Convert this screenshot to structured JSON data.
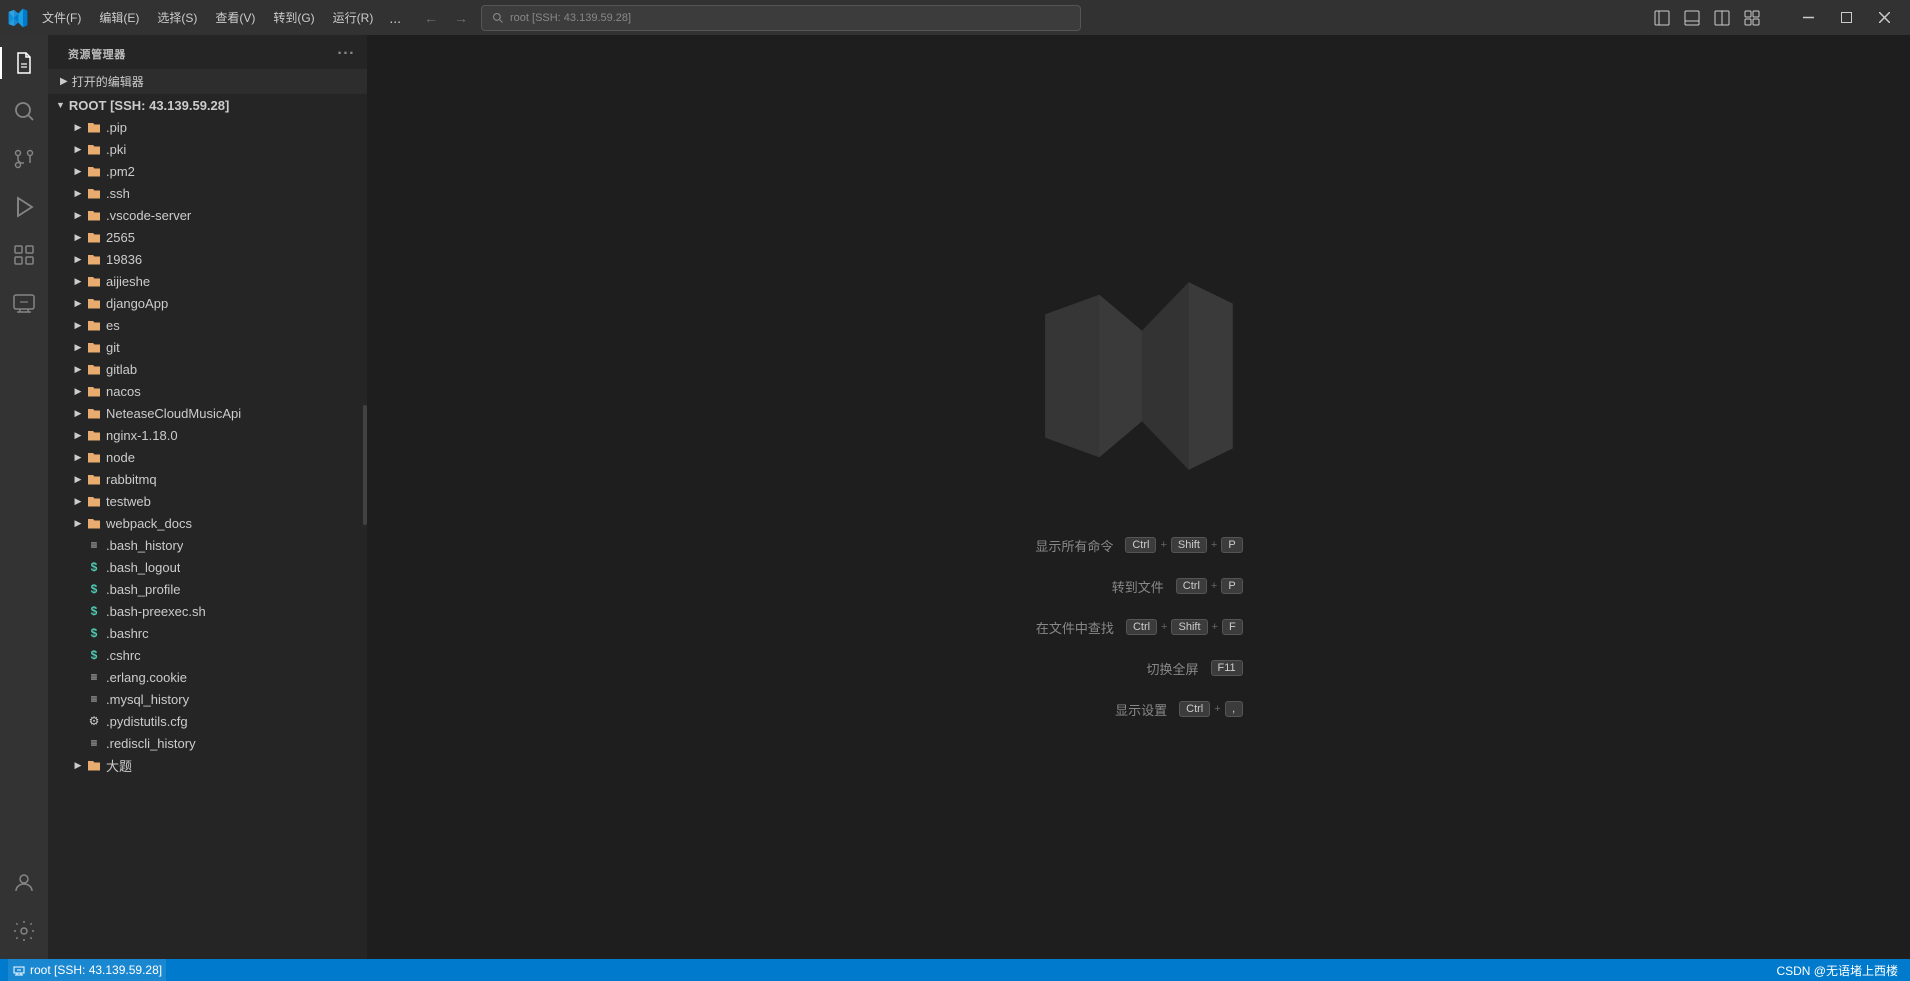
{
  "titleBar": {
    "appIcon": "VS",
    "menus": [
      "文件(F)",
      "编辑(E)",
      "选择(S)",
      "查看(V)",
      "转到(G)",
      "运行(R)",
      "..."
    ],
    "searchPlaceholder": "root [SSH: 43.139.59.28]",
    "navBack": "←",
    "navForward": "→",
    "layoutButtons": [
      "sidebar-toggle",
      "panel-toggle",
      "editor-layout",
      "customize"
    ],
    "windowButtons": {
      "minimize": "─",
      "maximize": "□",
      "close": "✕"
    }
  },
  "sidebar": {
    "title": "资源管理器",
    "dotsMenu": "···",
    "openEditors": "打开的编辑器",
    "rootLabel": "ROOT [SSH: 43.139.59.28]",
    "folders": [
      {
        "name": ".pip",
        "type": "folder",
        "indent": 1
      },
      {
        "name": ".pki",
        "type": "folder",
        "indent": 1
      },
      {
        "name": ".pm2",
        "type": "folder",
        "indent": 1
      },
      {
        "name": ".ssh",
        "type": "folder",
        "indent": 1
      },
      {
        "name": ".vscode-server",
        "type": "folder",
        "indent": 1
      },
      {
        "name": "2565",
        "type": "folder",
        "indent": 1
      },
      {
        "name": "19836",
        "type": "folder",
        "indent": 1
      },
      {
        "name": "aijieshe",
        "type": "folder",
        "indent": 1
      },
      {
        "name": "djangoApp",
        "type": "folder",
        "indent": 1
      },
      {
        "name": "es",
        "type": "folder",
        "indent": 1
      },
      {
        "name": "git",
        "type": "folder",
        "indent": 1
      },
      {
        "name": "gitlab",
        "type": "folder",
        "indent": 1
      },
      {
        "name": "nacos",
        "type": "folder",
        "indent": 1
      },
      {
        "name": "NeteaseCloudMusicApi",
        "type": "folder",
        "indent": 1
      },
      {
        "name": "nginx-1.18.0",
        "type": "folder",
        "indent": 1
      },
      {
        "name": "node",
        "type": "folder",
        "indent": 1
      },
      {
        "name": "rabbitmq",
        "type": "folder",
        "indent": 1
      },
      {
        "name": "testweb",
        "type": "folder",
        "indent": 1
      },
      {
        "name": "webpack_docs",
        "type": "folder",
        "indent": 1
      }
    ],
    "files": [
      {
        "name": ".bash_history",
        "type": "lines",
        "indent": 1
      },
      {
        "name": ".bash_logout",
        "type": "dollar",
        "indent": 1
      },
      {
        "name": ".bash_profile",
        "type": "dollar",
        "indent": 1
      },
      {
        "name": ".bash-preexec.sh",
        "type": "dollar",
        "indent": 1
      },
      {
        "name": ".bashrc",
        "type": "dollar",
        "indent": 1
      },
      {
        "name": ".cshrc",
        "type": "dollar",
        "indent": 1
      },
      {
        "name": ".erlang.cookie",
        "type": "lines",
        "indent": 1
      },
      {
        "name": ".mysql_history",
        "type": "lines",
        "indent": 1
      },
      {
        "name": ".pydistutils.cfg",
        "type": "gear",
        "indent": 1
      },
      {
        "name": ".rediscli_history",
        "type": "lines",
        "indent": 1
      },
      {
        "name": "大题",
        "type": "folder",
        "indent": 1
      }
    ]
  },
  "editor": {
    "commands": [
      {
        "label": "显示所有命令",
        "keys": [
          "Ctrl",
          "+",
          "Shift",
          "+",
          "P"
        ]
      },
      {
        "label": "转到文件",
        "keys": [
          "Ctrl",
          "+",
          "P"
        ]
      },
      {
        "label": "在文件中查找",
        "keys": [
          "Ctrl",
          "+",
          "Shift",
          "+",
          "F"
        ]
      },
      {
        "label": "切换全屏",
        "keys": [
          "F11"
        ]
      },
      {
        "label": "显示设置",
        "keys": [
          "Ctrl",
          "+",
          ","
        ]
      }
    ]
  },
  "statusBar": {
    "sshLabel": "root [SSH: 43.139.59.28]",
    "rightLabel": "CSDN @无语堵上西楼"
  },
  "activityBar": {
    "items": [
      {
        "name": "explorer",
        "icon": "files"
      },
      {
        "name": "search",
        "icon": "search"
      },
      {
        "name": "source-control",
        "icon": "source-control"
      },
      {
        "name": "run-debug",
        "icon": "run"
      },
      {
        "name": "extensions",
        "icon": "extensions"
      },
      {
        "name": "remote-explorer",
        "icon": "remote"
      }
    ],
    "bottomItems": [
      {
        "name": "accounts",
        "icon": "account"
      },
      {
        "name": "settings",
        "icon": "settings"
      }
    ]
  }
}
